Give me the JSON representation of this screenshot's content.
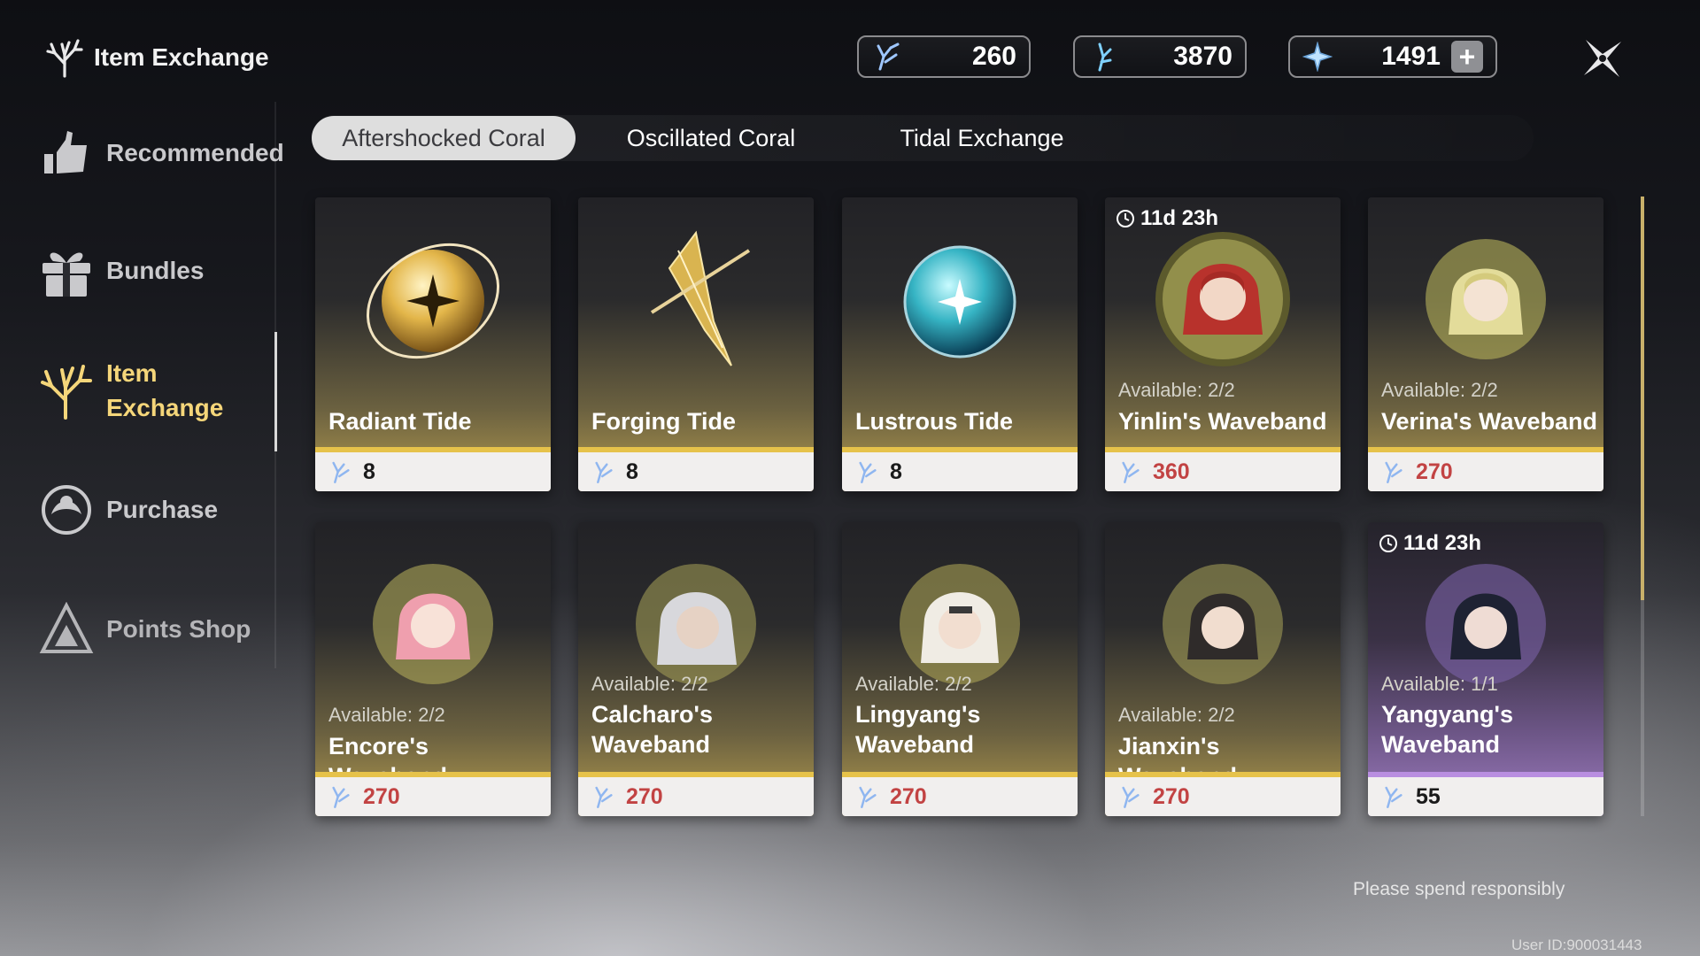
{
  "header": {
    "title": "Item Exchange",
    "title_icon": "coral-icon",
    "currencies": [
      {
        "icon": "aftershocked-coral-icon",
        "value": "260"
      },
      {
        "icon": "oscillated-coral-icon",
        "value": "3870"
      },
      {
        "icon": "astrite-icon",
        "value": "1491",
        "plus": "+"
      }
    ],
    "close_icon": "close-icon"
  },
  "sidebar": {
    "items": [
      {
        "label": "Recommended",
        "icon": "recommended-icon"
      },
      {
        "label": "Bundles",
        "icon": "gift-icon"
      },
      {
        "label": "Item\nExchange",
        "icon": "coral-icon",
        "active": true
      },
      {
        "label": "Purchase",
        "icon": "purchase-icon"
      },
      {
        "label": "Points Shop",
        "icon": "triangle-icon"
      }
    ]
  },
  "tabs": [
    {
      "label": "Aftershocked Coral",
      "active": true
    },
    {
      "label": "Oscillated Coral"
    },
    {
      "label": "Tidal Exchange"
    }
  ],
  "items": [
    {
      "name": "Radiant Tide",
      "price": "8",
      "price_color": "dark",
      "art": "gold-orb-icon"
    },
    {
      "name": "Forging Tide",
      "price": "8",
      "price_color": "dark",
      "art": "blade-icon"
    },
    {
      "name": "Lustrous Tide",
      "price": "8",
      "price_color": "dark",
      "art": "teal-orb-icon"
    },
    {
      "name": "Yinlin's Waveband",
      "available": "Available: 2/2",
      "price": "360",
      "price_color": "red",
      "timer": "11d 23h",
      "art": "portrait-icon"
    },
    {
      "name": "Verina's Waveband",
      "available": "Available: 2/2",
      "price": "270",
      "price_color": "red",
      "art": "portrait-icon"
    },
    {
      "name": "Encore's Waveband",
      "available": "Available: 2/2",
      "price": "270",
      "price_color": "red",
      "art": "portrait-icon"
    },
    {
      "name": "Calcharo's\nWaveband",
      "available": "Available: 2/2",
      "price": "270",
      "price_color": "red",
      "art": "portrait-icon"
    },
    {
      "name": "Lingyang's\nWaveband",
      "available": "Available: 2/2",
      "price": "270",
      "price_color": "red",
      "art": "portrait-icon"
    },
    {
      "name": "Jianxin's Waveband",
      "available": "Available: 2/2",
      "price": "270",
      "price_color": "red",
      "art": "portrait-icon"
    },
    {
      "name": "Yangyang's\nWaveband",
      "available": "Available: 1/1",
      "price": "55",
      "price_color": "dark",
      "timer": "11d 23h",
      "art": "portrait-icon",
      "variant": "purple"
    }
  ],
  "footer": {
    "note": "Please spend responsibly",
    "user_id": "User ID:900031443"
  },
  "colors": {
    "accent_gold": "#e6c24a",
    "accent_purple": "#b98ee0",
    "price_red": "#c24343"
  }
}
